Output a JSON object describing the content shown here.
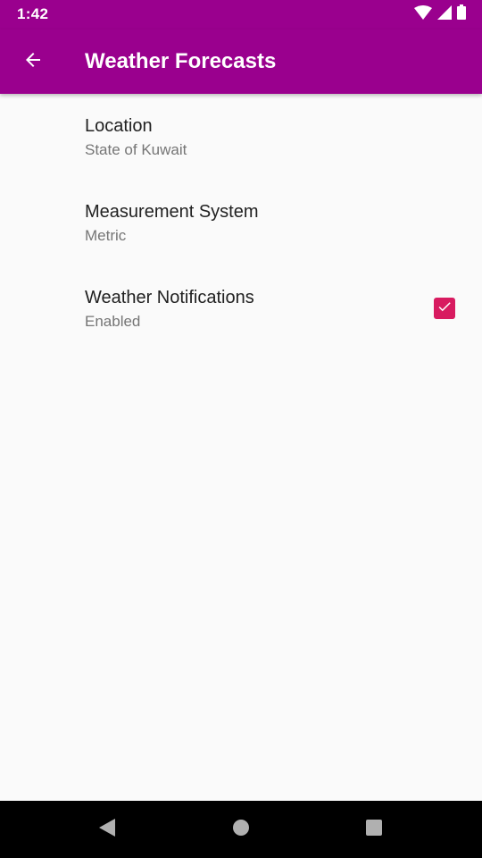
{
  "status_bar": {
    "time": "1:42",
    "icons": [
      "wifi-icon",
      "cellular-signal-icon",
      "battery-icon"
    ]
  },
  "app_bar": {
    "title": "Weather Forecasts",
    "back_icon": "arrow-back-icon"
  },
  "preferences": [
    {
      "title": "Location",
      "summary": "State of Kuwait"
    },
    {
      "title": "Measurement System",
      "summary": "Metric"
    },
    {
      "title": "Weather Notifications",
      "summary": "Enabled",
      "checked": true
    }
  ],
  "nav_bar": {
    "buttons": [
      "back-triangle-icon",
      "home-circle-icon",
      "recents-square-icon"
    ]
  },
  "colors": {
    "primary": "#9a008e",
    "accent": "#d81b60",
    "background": "#fafafa",
    "text_primary": "#212121",
    "text_secondary": "#757575"
  }
}
